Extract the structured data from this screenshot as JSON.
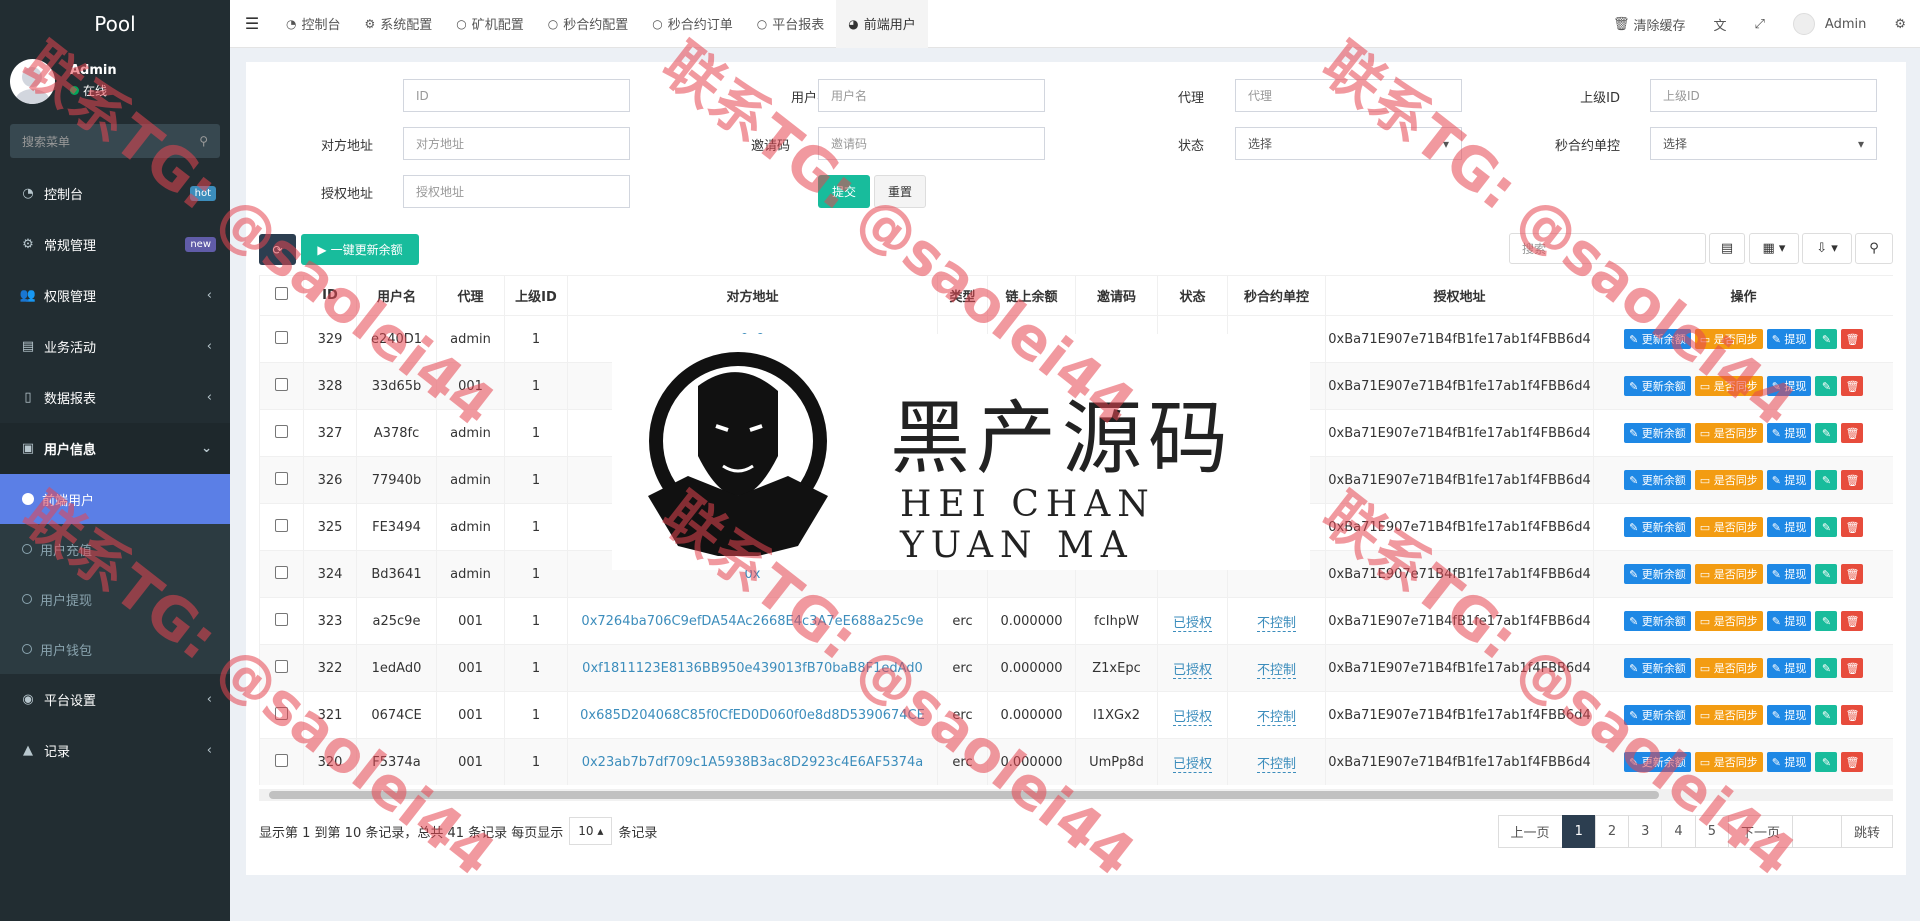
{
  "sidebar": {
    "brand": "Pool",
    "user": {
      "name": "Admin",
      "status": "在线"
    },
    "search_placeholder": "搜索菜单",
    "items": [
      {
        "label": "控制台",
        "badge": "hot",
        "icon": "dashboard-icon"
      },
      {
        "label": "常规管理",
        "badge": "new",
        "icon": "cogs-icon"
      },
      {
        "label": "权限管理",
        "icon": "group-icon"
      },
      {
        "label": "业务活动",
        "icon": "card-icon"
      },
      {
        "label": "数据报表",
        "icon": "file-icon"
      },
      {
        "label": "用户信息",
        "icon": "user-icon"
      }
    ],
    "sub_items": [
      "前端用户",
      "用户充值",
      "用户提现",
      "用户钱包"
    ],
    "bottom_items": [
      {
        "label": "平台设置",
        "icon": "settings-icon"
      },
      {
        "label": "记录",
        "icon": "chart-icon"
      }
    ]
  },
  "topbar": {
    "tabs": [
      "控制台",
      "系统配置",
      "矿机配置",
      "秒合约配置",
      "秒合约订单",
      "平台报表",
      "前端用户"
    ],
    "clear_cache": "清除缓存",
    "admin": "Admin"
  },
  "filters": {
    "id_label": "ID",
    "id_placeholder": "ID",
    "username_label": "用户名",
    "username_placeholder": "用户名",
    "agent_label": "代理",
    "agent_placeholder": "代理",
    "parent_label": "上级ID",
    "parent_placeholder": "上级ID",
    "address_label": "对方地址",
    "address_placeholder": "对方地址",
    "invite_label": "邀请码",
    "invite_placeholder": "邀请码",
    "status_label": "状态",
    "status_value": "选择",
    "control_label": "秒合约单控",
    "control_value": "选择",
    "auth_label": "授权地址",
    "auth_placeholder": "授权地址",
    "submit": "提交",
    "reset": "重置"
  },
  "toolbar": {
    "update_balance": "一键更新余额",
    "search_placeholder": "搜索"
  },
  "table": {
    "headers": [
      "ID",
      "用户名",
      "代理",
      "上级ID",
      "对方地址",
      "类型",
      "链上余额",
      "邀请码",
      "状态",
      "秒合约单控",
      "授权地址",
      "操作"
    ],
    "rows": [
      {
        "id": "329",
        "user": "e240D1",
        "agent": "admin",
        "parent": "1",
        "addr": "0x9",
        "type": "",
        "bal": "",
        "code": "",
        "status": "",
        "ctrl": "",
        "auth": "0xBa71E907e71B4fB1fe17ab1f4FBB6d4"
      },
      {
        "id": "328",
        "user": "33d65b",
        "agent": "001",
        "parent": "1",
        "addr": "0xe",
        "type": "",
        "bal": "",
        "code": "",
        "status": "",
        "ctrl": "",
        "auth": "0xBa71E907e71B4fB1fe17ab1f4FBB6d4"
      },
      {
        "id": "327",
        "user": "A378fc",
        "agent": "admin",
        "parent": "1",
        "addr": "0x",
        "type": "",
        "bal": "",
        "code": "",
        "status": "",
        "ctrl": "",
        "auth": "0xBa71E907e71B4fB1fe17ab1f4FBB6d4"
      },
      {
        "id": "326",
        "user": "77940b",
        "agent": "admin",
        "parent": "1",
        "addr": "0xc",
        "type": "",
        "bal": "",
        "code": "",
        "status": "",
        "ctrl": "",
        "auth": "0xBa71E907e71B4fB1fe17ab1f4FBB6d4"
      },
      {
        "id": "325",
        "user": "FE3494",
        "agent": "admin",
        "parent": "1",
        "addr": "0x",
        "type": "",
        "bal": "",
        "code": "",
        "status": "",
        "ctrl": "",
        "auth": "0xBa71E907e71B4fB1fe17ab1f4FBB6d4"
      },
      {
        "id": "324",
        "user": "Bd3641",
        "agent": "admin",
        "parent": "1",
        "addr": "0x",
        "type": "",
        "bal": "",
        "code": "",
        "status": "",
        "ctrl": "",
        "auth": "0xBa71E907e71B4fB1fe17ab1f4FBB6d4"
      },
      {
        "id": "323",
        "user": "a25c9e",
        "agent": "001",
        "parent": "1",
        "addr": "0x7264ba706C9efDA54Ac2668E4c3A7eE688a25c9e",
        "type": "erc",
        "bal": "0.000000",
        "code": "fcIhpW",
        "status": "已授权",
        "ctrl": "不控制",
        "auth": "0xBa71E907e71B4fB1fe17ab1f4FBB6d4"
      },
      {
        "id": "322",
        "user": "1edAd0",
        "agent": "001",
        "parent": "1",
        "addr": "0xf1811123E8136BB950e439013fB70baB8F1edAd0",
        "type": "erc",
        "bal": "0.000000",
        "code": "Z1xEpc",
        "status": "已授权",
        "ctrl": "不控制",
        "auth": "0xBa71E907e71B4fB1fe17ab1f4FBB6d4"
      },
      {
        "id": "321",
        "user": "0674CE",
        "agent": "001",
        "parent": "1",
        "addr": "0x685D204068C85f0CfED0D060f0e8d8D5390674CE",
        "type": "erc",
        "bal": "0.000000",
        "code": "I1XGx2",
        "status": "已授权",
        "ctrl": "不控制",
        "auth": "0xBa71E907e71B4fB1fe17ab1f4FBB6d4"
      },
      {
        "id": "320",
        "user": "F5374a",
        "agent": "001",
        "parent": "1",
        "addr": "0x23ab7b7df709c1A5938B3ac8D2923c4E6AF5374a",
        "type": "erc",
        "bal": "0.000000",
        "code": "UmPp8d",
        "status": "已授权",
        "ctrl": "不控制",
        "auth": "0xBa71E907e71B4fB1fe17ab1f4FBB6d4"
      }
    ],
    "ops": {
      "update": "更新余额",
      "sync": "是否同步",
      "withdraw": "提现"
    }
  },
  "footer": {
    "summary": "显示第 1 到第 10 条记录，总共 41 条记录 每页显示",
    "page_size": "10",
    "suffix": "条记录",
    "prev": "上一页",
    "pages": [
      "1",
      "2",
      "3",
      "4",
      "5"
    ],
    "next": "下一页",
    "jump": "跳转"
  },
  "overlay": {
    "title": "黑产源码",
    "subtitle": "HEI CHAN YUAN MA",
    "watermark": "联系TG: @saolei44"
  },
  "colors": {
    "sidebar": "#222d32",
    "active": "#5b7fe6",
    "success": "#18bc9c",
    "primary": "#1e88e5",
    "warning": "#f39c12",
    "danger": "#e74c3c"
  }
}
